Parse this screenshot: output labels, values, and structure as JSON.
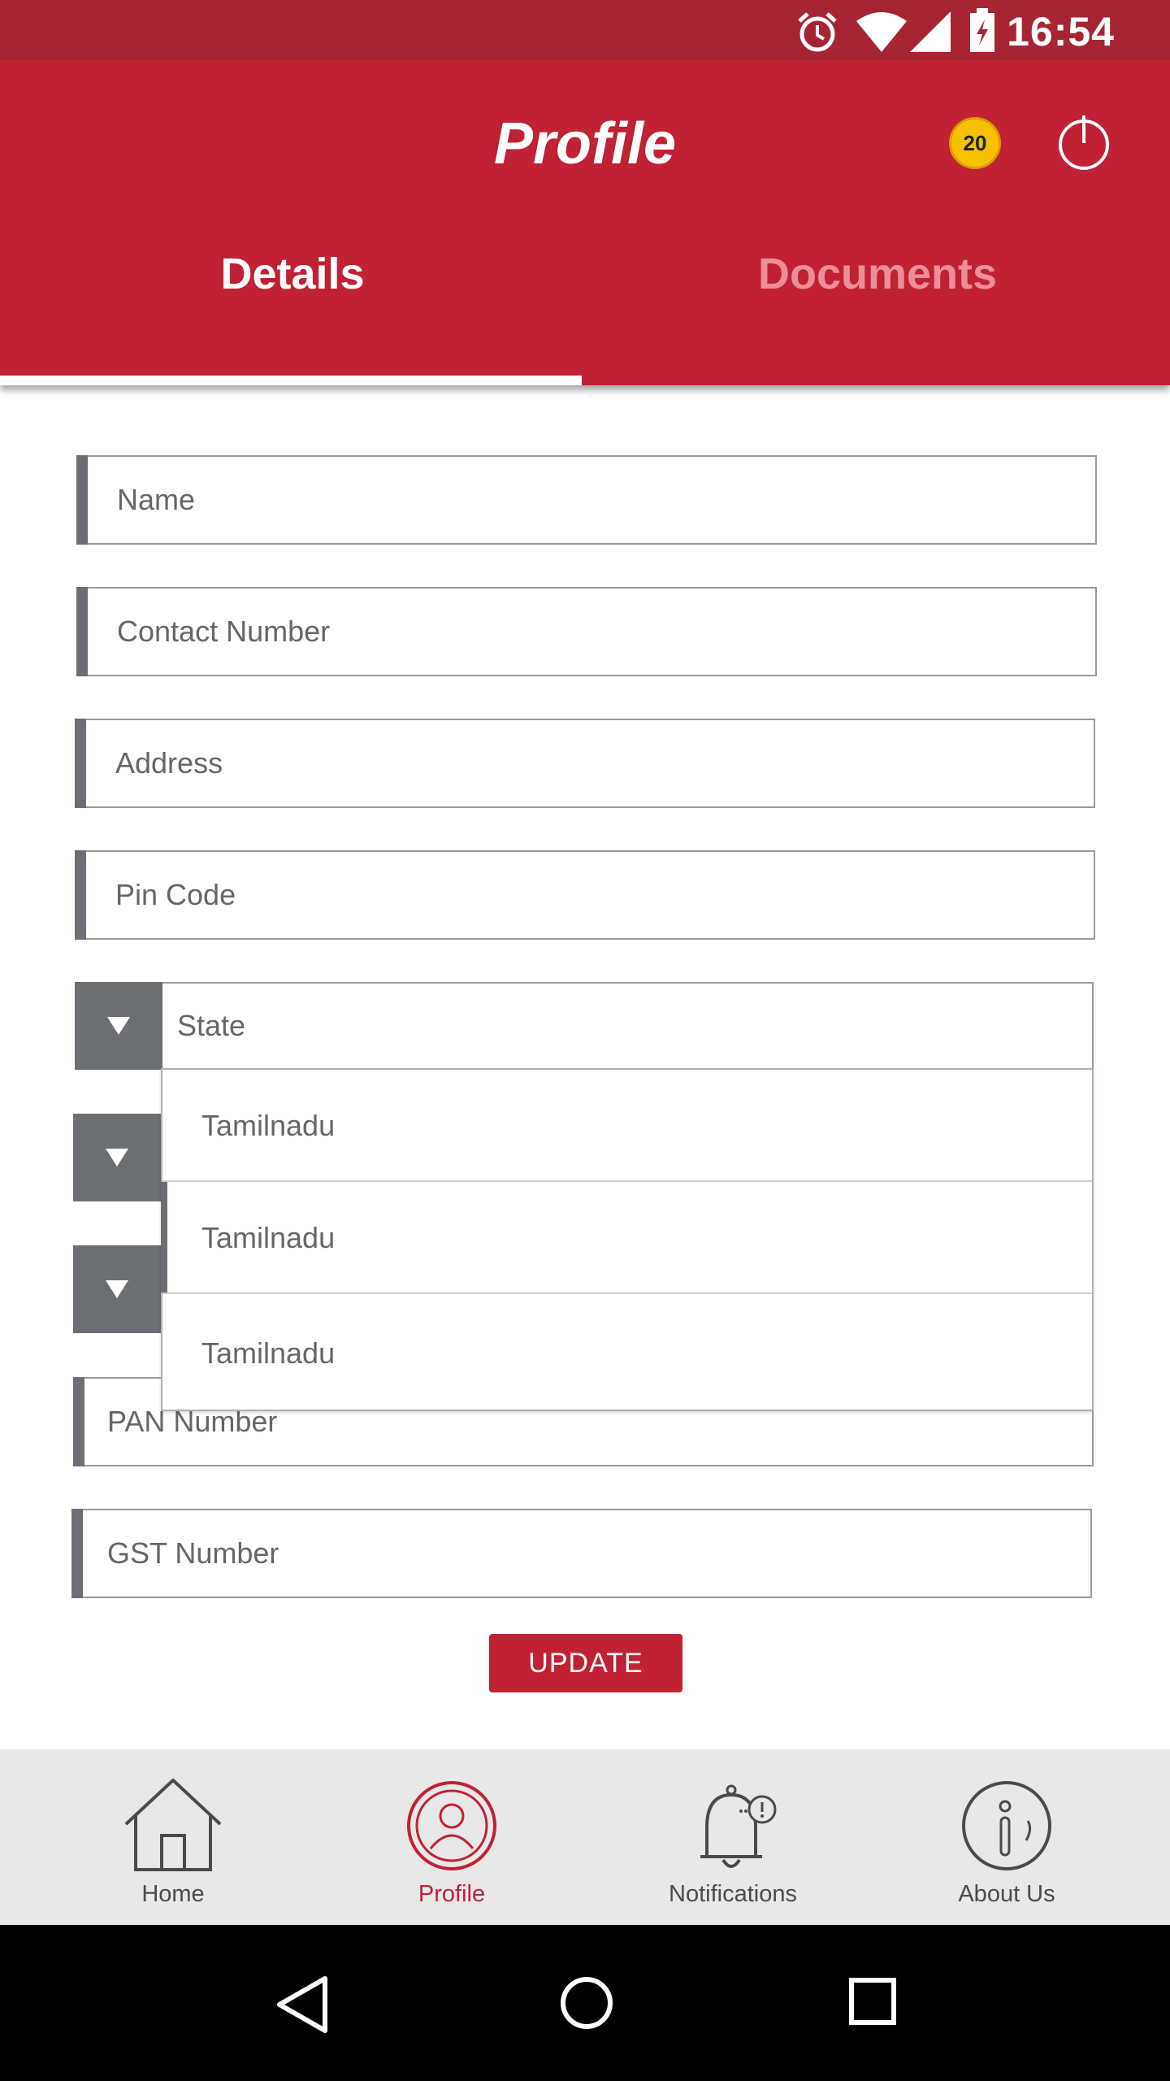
{
  "status_bar": {
    "time": "16:54",
    "icons": [
      "alarm-icon",
      "wifi-icon",
      "signal-icon",
      "battery-charging-icon"
    ]
  },
  "app_bar": {
    "title": "Profile",
    "coin_count": "20",
    "power_icon": "power-icon"
  },
  "tabs": [
    {
      "label": "Details",
      "active": true
    },
    {
      "label": "Documents",
      "active": false
    }
  ],
  "form": {
    "name_placeholder": "Name",
    "contact_placeholder": "Contact Number",
    "address_placeholder": "Address",
    "pincode_placeholder": "Pin Code",
    "state_label": "State",
    "pan_placeholder": "PAN Number",
    "gst_placeholder": "GST Number",
    "update_label": "UPDATE"
  },
  "dropdown": {
    "options": [
      "Tamilnadu",
      "Tamilnadu",
      "Tamilnadu"
    ]
  },
  "bottom_nav": [
    {
      "label": "Home",
      "icon": "home-icon",
      "active": false
    },
    {
      "label": "Profile",
      "icon": "profile-icon",
      "active": true
    },
    {
      "label": "Notifications",
      "icon": "bell-icon",
      "active": false
    },
    {
      "label": "About Us",
      "icon": "info-icon",
      "active": false
    }
  ],
  "colors": {
    "primary": "#c02133",
    "status_bar": "#a72433",
    "accent_grey": "#6b6f74",
    "coin": "#f6c200"
  }
}
